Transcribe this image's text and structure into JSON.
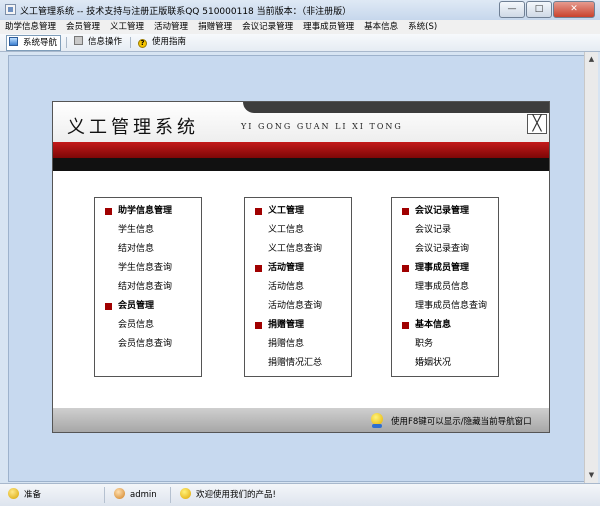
{
  "window": {
    "title": "义工管理系统 -- 技术支持与注册正版联系QQ 510000118    当前版本：（非注册版）",
    "buttons": {
      "minimize": "—",
      "maximize": "□",
      "close": "✕"
    }
  },
  "menu": {
    "items": [
      "助学信息管理",
      "会员管理",
      "义工管理",
      "活动管理",
      "捐赠管理",
      "会议记录管理",
      "理事成员管理",
      "基本信息",
      "系统(S)"
    ]
  },
  "toolbar": {
    "nav_label": "系统导航",
    "info_label": "信息操作",
    "help_label": "使用指南",
    "help_icon_glyph": "?"
  },
  "panel": {
    "title": "义工管理系统",
    "subtitle": "YI GONG GUAN LI XI TONG",
    "close_glyph": "╳",
    "band_color": "#b31212",
    "columns": [
      {
        "rows": [
          {
            "text": "助学信息管理",
            "kind": "head"
          },
          {
            "text": "学生信息",
            "kind": "item"
          },
          {
            "text": "结对信息",
            "kind": "item"
          },
          {
            "text": "学生信息查询",
            "kind": "item"
          },
          {
            "text": "结对信息查询",
            "kind": "item"
          },
          {
            "text": "会员管理",
            "kind": "head"
          },
          {
            "text": "会员信息",
            "kind": "item"
          },
          {
            "text": "会员信息查询",
            "kind": "item"
          }
        ]
      },
      {
        "rows": [
          {
            "text": "义工管理",
            "kind": "head"
          },
          {
            "text": "义工信息",
            "kind": "item"
          },
          {
            "text": "义工信息查询",
            "kind": "item"
          },
          {
            "text": "活动管理",
            "kind": "head"
          },
          {
            "text": "活动信息",
            "kind": "item"
          },
          {
            "text": "活动信息查询",
            "kind": "item"
          },
          {
            "text": "捐赠管理",
            "kind": "head"
          },
          {
            "text": "捐赠信息",
            "kind": "item"
          },
          {
            "text": "捐赠情况汇总",
            "kind": "item"
          }
        ]
      },
      {
        "rows": [
          {
            "text": "会议记录管理",
            "kind": "head"
          },
          {
            "text": "会议记录",
            "kind": "item"
          },
          {
            "text": "会议记录查询",
            "kind": "item"
          },
          {
            "text": "理事成员管理",
            "kind": "head"
          },
          {
            "text": "理事成员信息",
            "kind": "item"
          },
          {
            "text": "理事成员信息查询",
            "kind": "item"
          },
          {
            "text": "基本信息",
            "kind": "head"
          },
          {
            "text": "职务",
            "kind": "item"
          },
          {
            "text": "婚姻状况",
            "kind": "item"
          }
        ]
      }
    ],
    "footer_text": "使用F8键可以显示/隐藏当前导航窗口"
  },
  "scrollbar": {
    "up_glyph": "▲",
    "down_glyph": "▼"
  },
  "status": {
    "ready": "准备",
    "user": "admin",
    "welcome": "欢迎使用我们的产品!"
  }
}
